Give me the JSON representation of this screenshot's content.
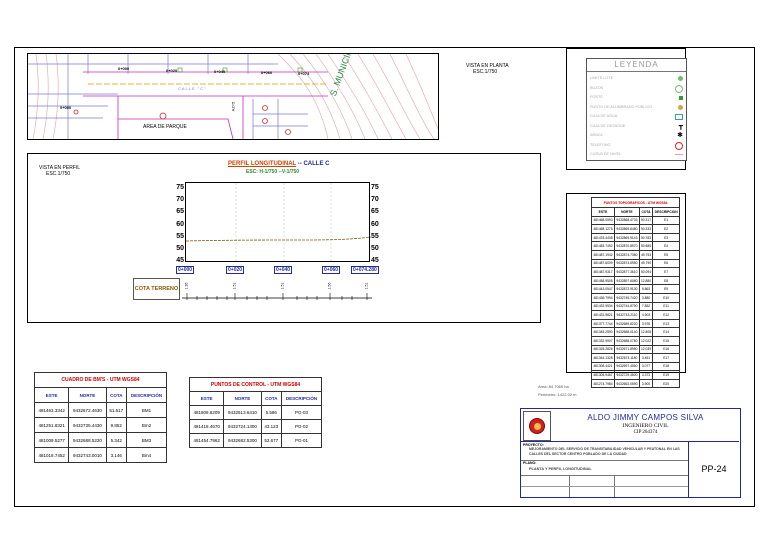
{
  "plan": {
    "label": "VISTA EN PLANTA",
    "scale": "ESC.1/750",
    "street": "CALLE \"C\"",
    "park": "AREA DE PARQUE",
    "municipal": "S. MUNICIPAL",
    "stations": [
      "0+000",
      "0+020",
      "0+040",
      "0+060",
      "0+074"
    ],
    "side_marks": [
      "0+000",
      "0+074",
      "AZ=5",
      "AZ-34"
    ]
  },
  "profile": {
    "view_label": "VISTA EN PERFIL",
    "view_scale": "ESC.1/750",
    "title": "PERFIL LONGITUDINAL",
    "title_sep": "--",
    "title_street": "CALLE C",
    "scale_text": "ESC: H-1/750 --V-1/750",
    "y_ticks": [
      "75",
      "70",
      "65",
      "60",
      "55",
      "50",
      "45"
    ],
    "stations": [
      "0+000",
      "0+020",
      "0+040",
      "0+060",
      "0+074.280"
    ],
    "cota_label": "COTA TERRENO",
    "cota_values": [
      "1.36",
      "1.51",
      "1.51",
      "1.56",
      "1.51"
    ]
  },
  "legend": {
    "title": "LEYENDA",
    "items": [
      "LIMITE LOTE",
      "BUZON",
      "POSTE",
      "PUNTO DE ALUMBRADO PUBLICO",
      "CAJA DE AGUA",
      "CAJA DE DESAGÜE",
      "ARBOL",
      "TELEFONO",
      "CURVA DE NIVEL"
    ]
  },
  "bms": {
    "title": "CUADRO DE BM'S - UTM WGS84",
    "headers": [
      "ESTE",
      "NORTE",
      "COTA",
      "DESCRIPCIÓN"
    ],
    "rows": [
      [
        "481463.3342",
        "9432672.4630",
        "51.517",
        "BM1"
      ],
      [
        "481251.8321",
        "9432735.4430",
        "9.852",
        "Bm2"
      ],
      [
        "481008.5277",
        "9432688.5220",
        "5.342",
        "BM3"
      ],
      [
        "481018.7452",
        "9432743.0010",
        "3.146",
        "Bm4"
      ]
    ]
  },
  "control": {
    "title": "PUNTOS DE CONTROL - UTM WGS84",
    "headers": [
      "ESTE",
      "NORTE",
      "COTA",
      "DESCRIPCIÓN"
    ],
    "rows": [
      [
        "481809.8209",
        "9432513.6410",
        "5.596",
        "PG-03"
      ],
      [
        "481418.4670",
        "9432724.1300",
        "43.123",
        "PG-02"
      ],
      [
        "481454.7962",
        "9432682.5300",
        "52.677",
        "PG-01"
      ]
    ]
  },
  "topo": {
    "title": "PUNTOS TOPOGRAFICOS - UTM WGS84",
    "headers": [
      "ESTE",
      "NORTE",
      "COTA",
      "DESCRIPCION"
    ],
    "rows": [
      [
        "481468.0593",
        "9432868.4733",
        "50.317",
        "E1"
      ],
      [
        "481468.1275",
        "9432869.8480",
        "50.333",
        "E2"
      ],
      [
        "481478.4438",
        "9432869.9143",
        "50.783",
        "E3"
      ],
      [
        "481483.7492",
        "9432870.8970",
        "50.685",
        "E4"
      ],
      [
        "481487.1942",
        "9432874.7380",
        "49.753",
        "E5"
      ],
      [
        "481487.6009",
        "9432874.6950",
        "49.790",
        "E6"
      ],
      [
        "481487.9317",
        "9432877.3610",
        "50.094",
        "E7"
      ],
      [
        "481458.9505",
        "9432897.6080",
        "12.880",
        "E8"
      ],
      [
        "481443.0547",
        "9432872.9130",
        "5.863",
        "E9"
      ],
      [
        "481436.7994",
        "9432745.7420",
        "3.880",
        "E10"
      ],
      [
        "481432.9534",
        "9432744.8790",
        "7.852",
        "E11"
      ],
      [
        "481431.9821",
        "9432743.2110",
        "4.903",
        "E12"
      ],
      [
        "481377.7744",
        "9432689.8220",
        "3.976",
        "E13"
      ],
      [
        "481345.2590",
        "9432688.0140",
        "12.808",
        "E14"
      ],
      [
        "481332.9907",
        "9432688.0780",
        "12.022",
        "E15"
      ],
      [
        "481325.2826",
        "9432671.8950",
        "12.039",
        "E16"
      ],
      [
        "481344.1328",
        "9432674.1180",
        "3.451",
        "E17"
      ],
      [
        "481308.4421",
        "9432697.4060",
        "3.077",
        "E18"
      ],
      [
        "481305.9467",
        "9432729.4600",
        "3.373",
        "E19"
      ],
      [
        "481274.7984",
        "9432662.0590",
        "3.900",
        "E20"
      ]
    ]
  },
  "area": {
    "area_text": "Area: 84.7069 ha",
    "perimeter_text": "Perimetro: 1422.02 m"
  },
  "titleblock": {
    "engineer": "ALDO JIMMY CAMPOS SILVA",
    "profession": "INGENIERO CIVIL",
    "cip": "CIP 264374",
    "project_label": "PROYECTO:",
    "project_text": "MEJORAMIENTO DEL SERVICIO DE TRANSITABILIDAD VEHICULAR Y PEATONAL EN LAS CALLES DEL SECTOR CENTRO POBLADO DE LA CIUDAD",
    "plan_label": "PLANO:",
    "plan_text": "PLANTA Y PERFIL LONGITUDINAL",
    "sheet": "PP-24"
  }
}
